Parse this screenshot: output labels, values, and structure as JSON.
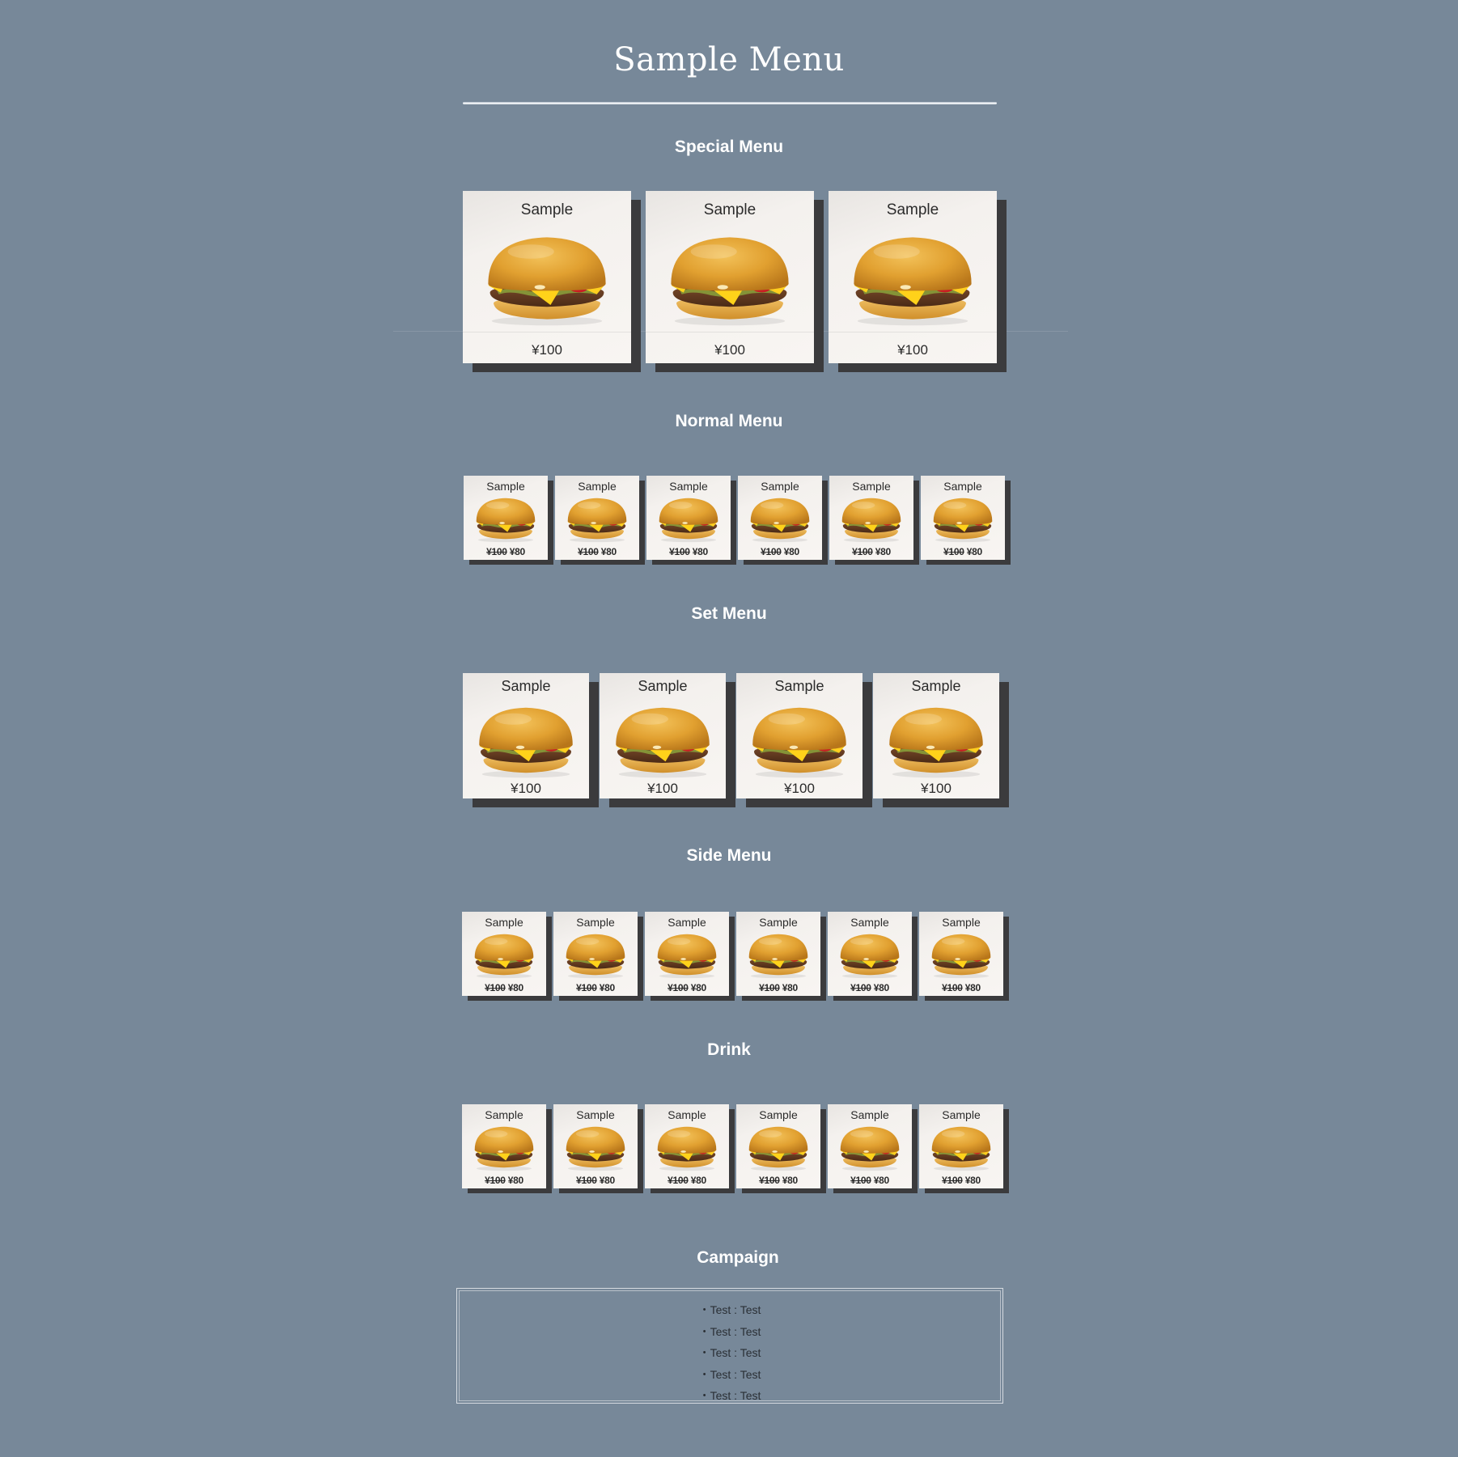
{
  "page": {
    "title": "Sample Menu"
  },
  "colors": {
    "background": "#778899",
    "card_shadow": "#3b3b3d",
    "heading": "#ffffff"
  },
  "sections": {
    "special": {
      "title": "Special Menu",
      "items": [
        {
          "name": "Sample",
          "price": "¥100"
        },
        {
          "name": "Sample",
          "price": "¥100"
        },
        {
          "name": "Sample",
          "price": "¥100"
        }
      ]
    },
    "normal": {
      "title": "Normal Menu",
      "items": [
        {
          "name": "Sample",
          "old_price": "¥100",
          "price": "¥80"
        },
        {
          "name": "Sample",
          "old_price": "¥100",
          "price": "¥80"
        },
        {
          "name": "Sample",
          "old_price": "¥100",
          "price": "¥80"
        },
        {
          "name": "Sample",
          "old_price": "¥100",
          "price": "¥80"
        },
        {
          "name": "Sample",
          "old_price": "¥100",
          "price": "¥80"
        },
        {
          "name": "Sample",
          "old_price": "¥100",
          "price": "¥80"
        }
      ]
    },
    "set": {
      "title": "Set Menu",
      "items": [
        {
          "name": "Sample",
          "price": "¥100"
        },
        {
          "name": "Sample",
          "price": "¥100"
        },
        {
          "name": "Sample",
          "price": "¥100"
        },
        {
          "name": "Sample",
          "price": "¥100"
        }
      ]
    },
    "side": {
      "title": "Side Menu",
      "items": [
        {
          "name": "Sample",
          "old_price": "¥100",
          "price": "¥80"
        },
        {
          "name": "Sample",
          "old_price": "¥100",
          "price": "¥80"
        },
        {
          "name": "Sample",
          "old_price": "¥100",
          "price": "¥80"
        },
        {
          "name": "Sample",
          "old_price": "¥100",
          "price": "¥80"
        },
        {
          "name": "Sample",
          "old_price": "¥100",
          "price": "¥80"
        },
        {
          "name": "Sample",
          "old_price": "¥100",
          "price": "¥80"
        }
      ]
    },
    "drink": {
      "title": "Drink",
      "items": [
        {
          "name": "Sample",
          "old_price": "¥100",
          "price": "¥80"
        },
        {
          "name": "Sample",
          "old_price": "¥100",
          "price": "¥80"
        },
        {
          "name": "Sample",
          "old_price": "¥100",
          "price": "¥80"
        },
        {
          "name": "Sample",
          "old_price": "¥100",
          "price": "¥80"
        },
        {
          "name": "Sample",
          "old_price": "¥100",
          "price": "¥80"
        },
        {
          "name": "Sample",
          "old_price": "¥100",
          "price": "¥80"
        }
      ]
    }
  },
  "campaign": {
    "title": "Campaign",
    "items": [
      "・Test : Test",
      "・Test : Test",
      "・Test : Test",
      "・Test : Test",
      "・Test : Test"
    ]
  },
  "icons": {
    "item_image": "cheeseburger-icon"
  }
}
